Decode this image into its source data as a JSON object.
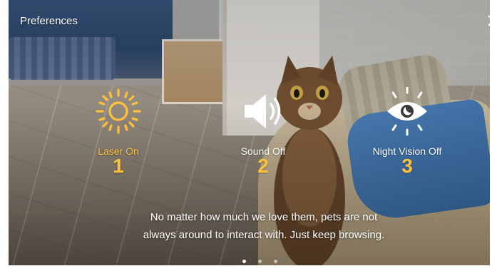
{
  "header": {
    "title": "Preferences",
    "close_icon": "close-icon"
  },
  "features": [
    {
      "label": "Laser On",
      "number": "1",
      "icon": "sun-icon",
      "active": true,
      "color": "#ffc13b"
    },
    {
      "label": "Sound Off",
      "number": "2",
      "icon": "speaker-icon",
      "active": false,
      "color": "#ffffff"
    },
    {
      "label": "Night Vision Off",
      "number": "3",
      "icon": "eye-icon",
      "active": false,
      "color": "#ffffff"
    }
  ],
  "caption": {
    "line1": "No matter how much we love them, pets are not",
    "line2": "always around to interact with. Just keep browsing."
  },
  "pagination": {
    "count": 3,
    "active_index": 0
  },
  "colors": {
    "accent": "#ffc13b",
    "text": "#ffffff"
  }
}
